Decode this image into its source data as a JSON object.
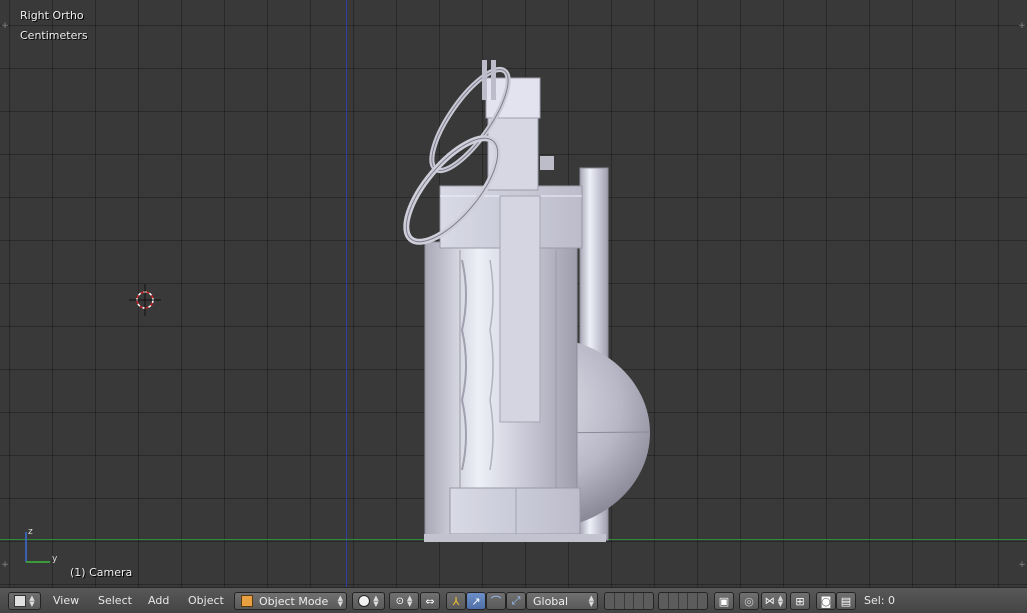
{
  "viewport": {
    "view_name": "Right Ortho",
    "units": "Centimeters",
    "object_label": "(1) Camera",
    "axis_labels": {
      "z": "z",
      "y": "y"
    },
    "colors": {
      "background": "#393939",
      "axis_y_line": "#2f3fa0",
      "axis_x_line": "#2e8a36",
      "model": "#c9c9d6"
    }
  },
  "header": {
    "editor_type_icon": "cube-icon",
    "menus": [
      "View",
      "Select",
      "Add",
      "Object"
    ],
    "mode": {
      "label": "Object Mode",
      "icon": "object-mode-cube-icon"
    },
    "shading_icon": "solid-sphere-icon",
    "pivot_icon": "pivot-point-icon",
    "transform_icons": [
      "manipulator-axes-icon",
      "translate-arrow-icon",
      "rotate-arc-icon",
      "scale-icon"
    ],
    "orientation": "Global",
    "snap_icons": [
      "proportional-edit-icon",
      "snap-icon",
      "snap-target-icon"
    ],
    "render_icons": [
      "render-still-icon",
      "render-animation-icon"
    ],
    "selection": "Sel: 0"
  }
}
